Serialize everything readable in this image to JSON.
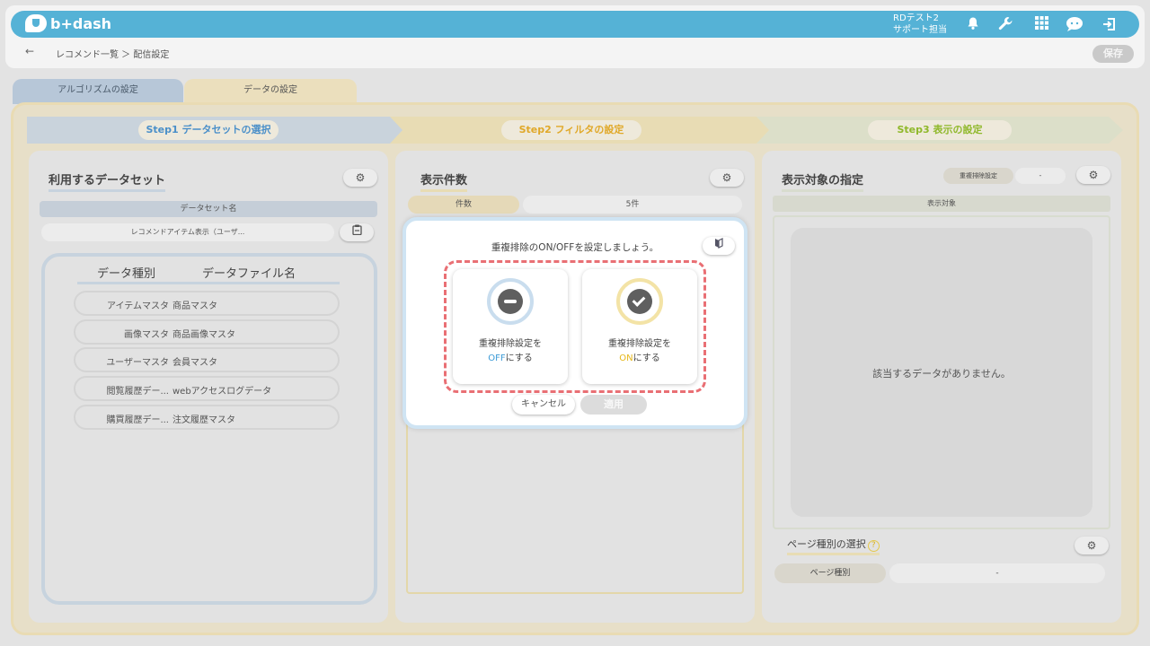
{
  "header": {
    "logo_text": "b+dash",
    "user_line1": "RDテスト2",
    "user_line2": "サポート担当",
    "icons": [
      "bell-icon",
      "wrench-icon",
      "grid-icon",
      "chat-icon",
      "logout-icon"
    ]
  },
  "breadcrumb": {
    "back": "←",
    "path": "レコメンド一覧 ＞ 配信設定",
    "save_label": "保存"
  },
  "tabs": [
    {
      "label": "アルゴリズムの設定"
    },
    {
      "label": "データの設定"
    }
  ],
  "steps": [
    {
      "label": "Step1 データセットの選択",
      "color": "#4a8fc9"
    },
    {
      "label": "Step2 フィルタの設定",
      "color": "#e0a828"
    },
    {
      "label": "Step3 表示の設定",
      "color": "#8fb82a"
    }
  ],
  "left_panel": {
    "title": "利用するデータセット",
    "dataset_name_header": "データセット名",
    "dataset_name_value": "レコメンドアイテム表示（ユーザ...",
    "col_type": "データ種別",
    "col_file": "データファイル名",
    "rows": [
      {
        "type": "アイテムマスタ",
        "file": "商品マスタ"
      },
      {
        "type": "画像マスタ",
        "file": "商品画像マスタ"
      },
      {
        "type": "ユーザーマスタ",
        "file": "会員マスタ"
      },
      {
        "type": "閲覧履歴デー...",
        "file": "webアクセスログデータ"
      },
      {
        "type": "購買履歴デー...",
        "file": "注文履歴マスタ"
      }
    ]
  },
  "middle_panel": {
    "title": "表示件数",
    "count_label": "件数",
    "count_value": "5件"
  },
  "right_panel": {
    "title": "表示対象の指定",
    "dedup_label": "重複排除設定",
    "dedup_value": "-",
    "target_header": "表示対象",
    "no_data": "該当するデータがありません。",
    "page_type_title": "ページ種別の選択",
    "help_glyph": "?",
    "page_type_label": "ページ種別",
    "page_type_value": "-"
  },
  "modal": {
    "message": "重複排除のON/OFFを設定しましょう。",
    "off_line1": "重複排除設定を",
    "off_keyword": "OFF",
    "off_suffix": "にする",
    "on_line1": "重複排除設定を",
    "on_keyword": "ON",
    "on_suffix": "にする",
    "cancel_label": "キャンセル",
    "apply_label": "適用"
  }
}
